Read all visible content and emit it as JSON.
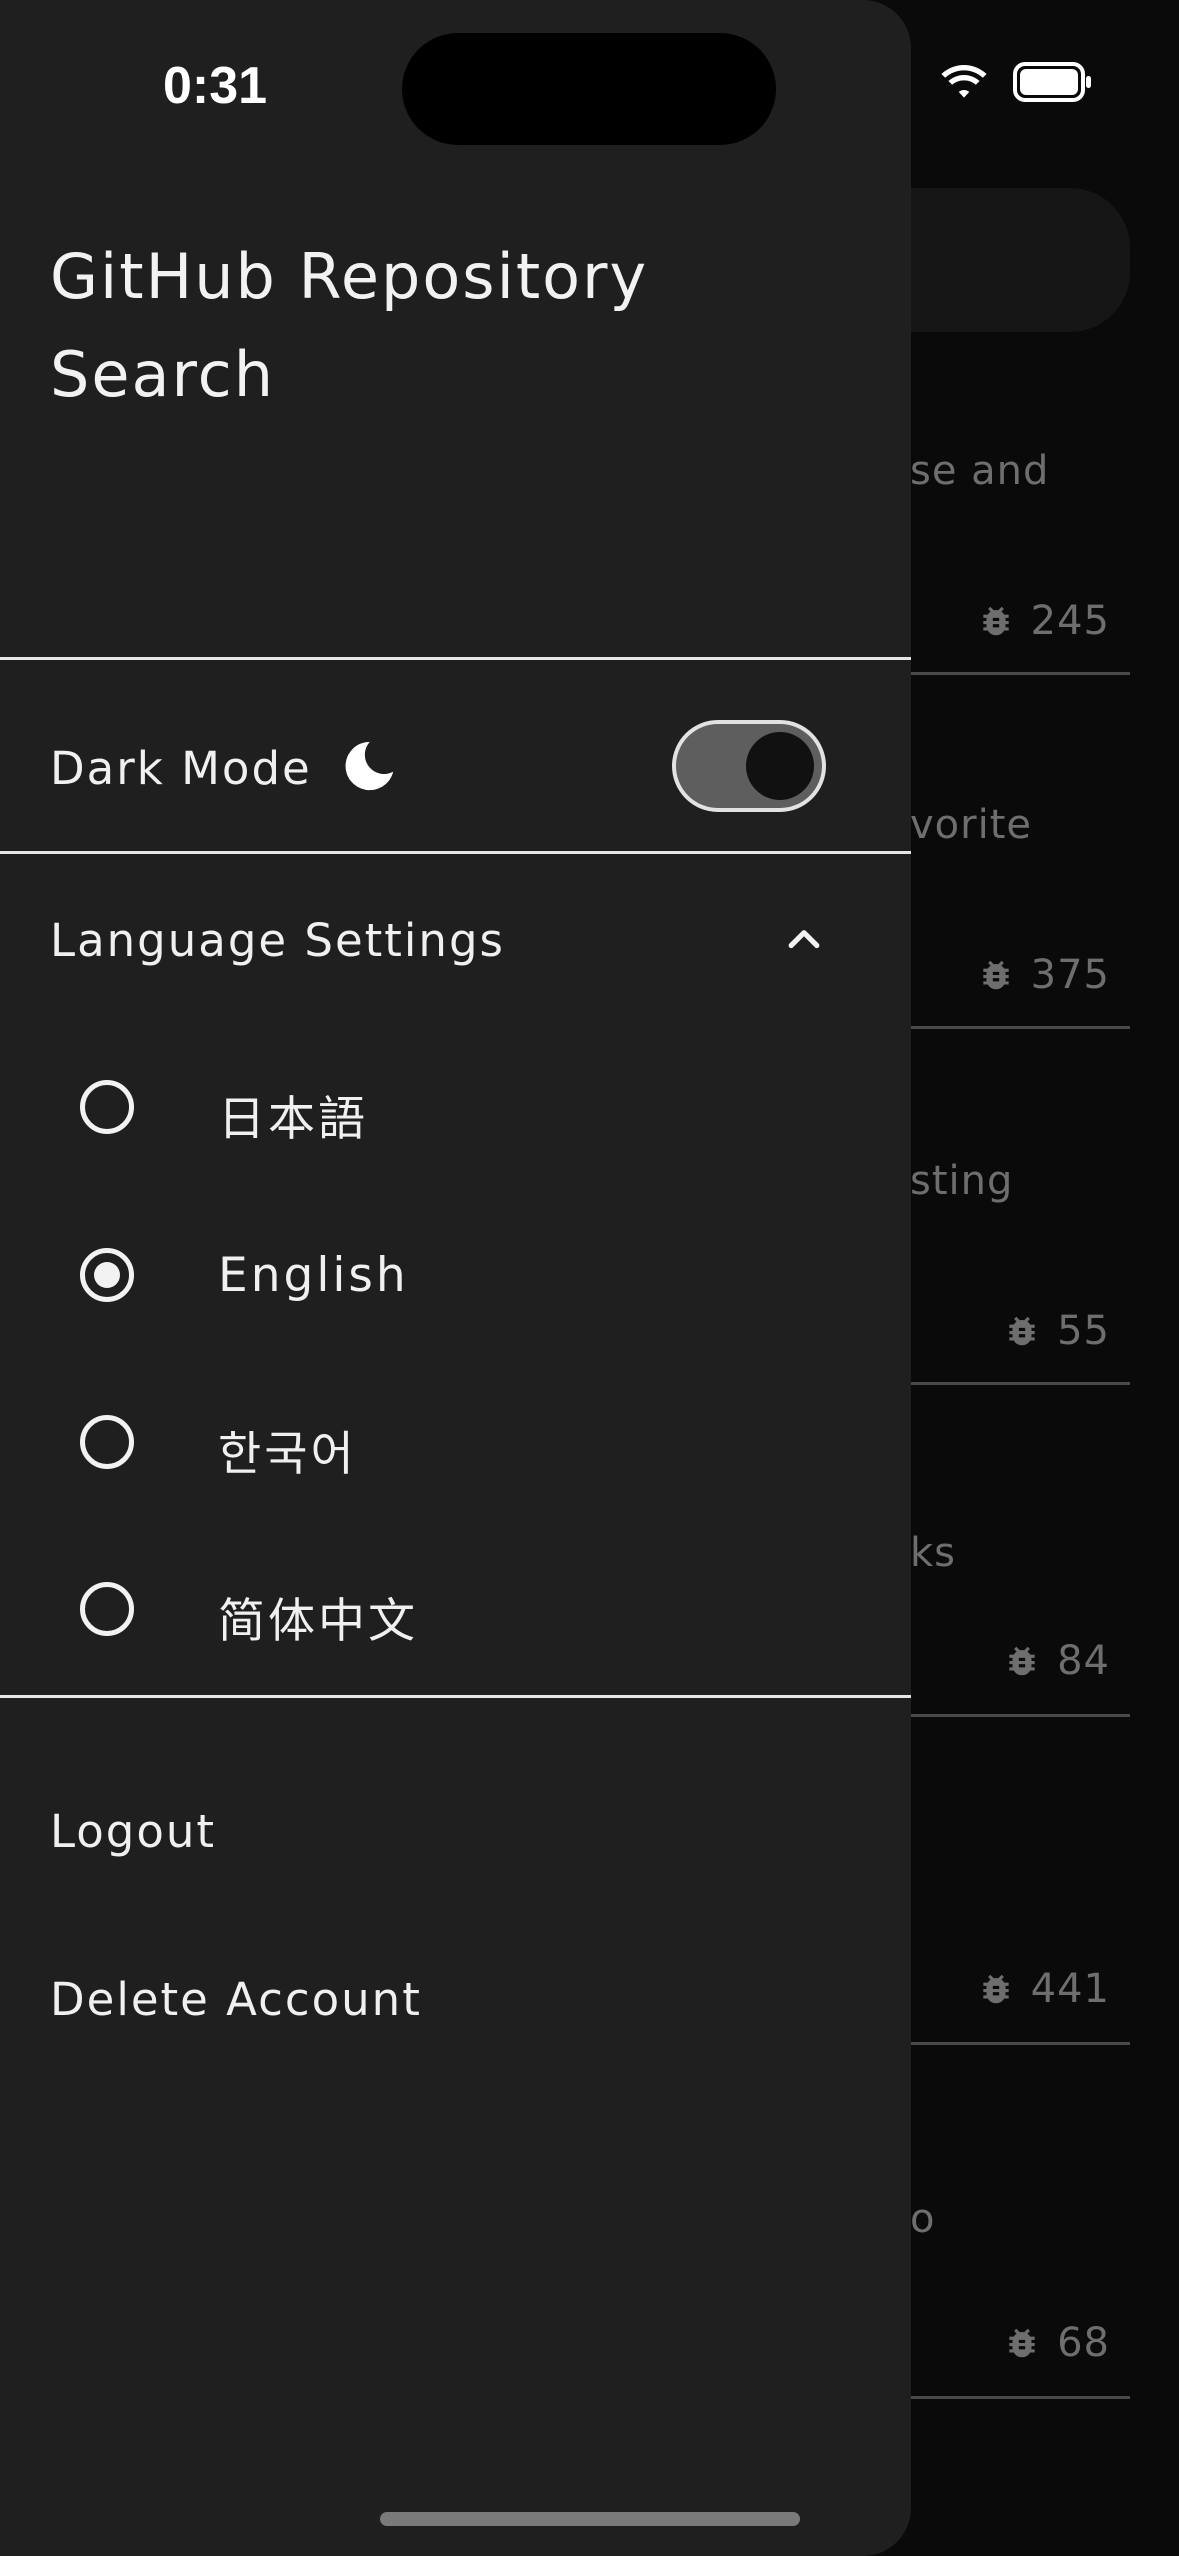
{
  "status_bar": {
    "time": "0:31"
  },
  "drawer": {
    "title": "GitHub Repository Search",
    "dark_mode": {
      "label": "Dark Mode",
      "enabled": true
    },
    "language_settings": {
      "label": "Language Settings",
      "expanded": true,
      "options": [
        {
          "label": "日本語",
          "selected": false
        },
        {
          "label": "English",
          "selected": true
        },
        {
          "label": "한국어",
          "selected": false
        },
        {
          "label": "简体中文",
          "selected": false
        }
      ]
    },
    "logout_label": "Logout",
    "delete_account_label": "Delete Account"
  },
  "background_list": {
    "items": [
      {
        "description_fragment": "se and",
        "issues": "245"
      },
      {
        "description_fragment": "vorite",
        "issues": "375"
      },
      {
        "description_fragment": "sting",
        "issues": "55"
      },
      {
        "description_fragment": "ks",
        "issues": "84"
      },
      {
        "description_fragment": "",
        "issues": "441"
      },
      {
        "description_fragment": "o",
        "issues": "68"
      }
    ]
  },
  "colors": {
    "drawer_bg": "#1f1f20",
    "page_bg": "#0a0a0a",
    "text": "#f0f0f0",
    "muted_text": "#6e6e6e"
  }
}
